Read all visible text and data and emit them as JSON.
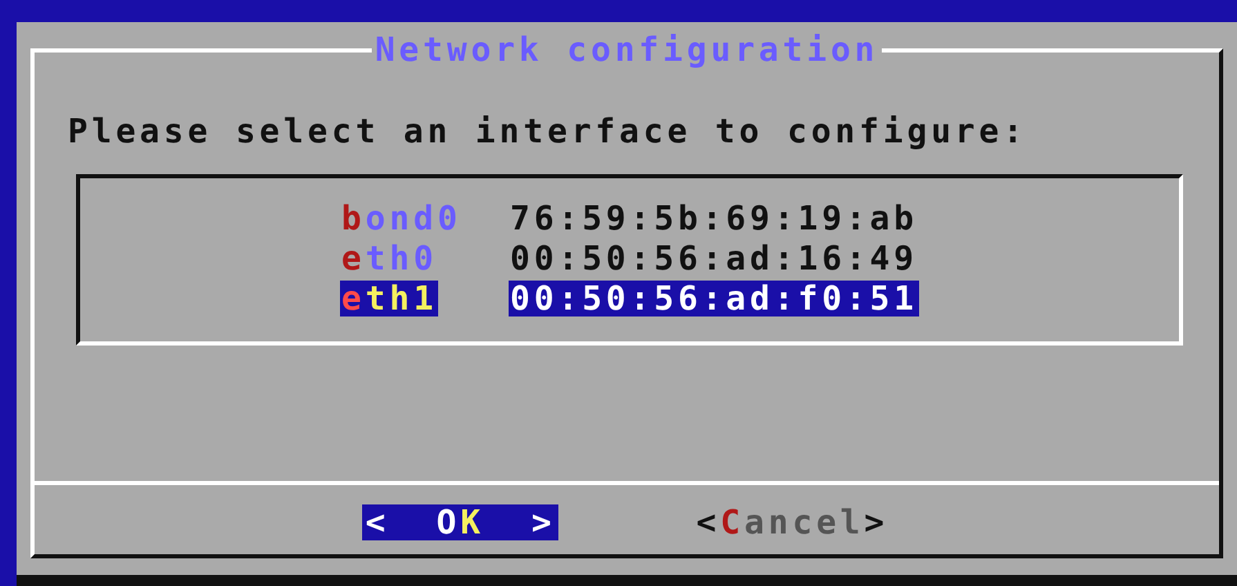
{
  "dialog": {
    "title": "Network configuration",
    "prompt": "Please select an interface to configure:",
    "interfaces": [
      {
        "name": "bond0",
        "mac": "76:59:5b:69:19:ab",
        "selected": false
      },
      {
        "name": "eth0",
        "mac": "00:50:56:ad:16:49",
        "selected": false
      },
      {
        "name": "eth1",
        "mac": "00:50:56:ad:f0:51",
        "selected": true
      }
    ],
    "buttons": [
      {
        "open": "<",
        "label": "OK",
        "close": ">",
        "selected": true
      },
      {
        "open": "<",
        "label": "Cancel",
        "close": ">",
        "selected": false
      }
    ]
  }
}
